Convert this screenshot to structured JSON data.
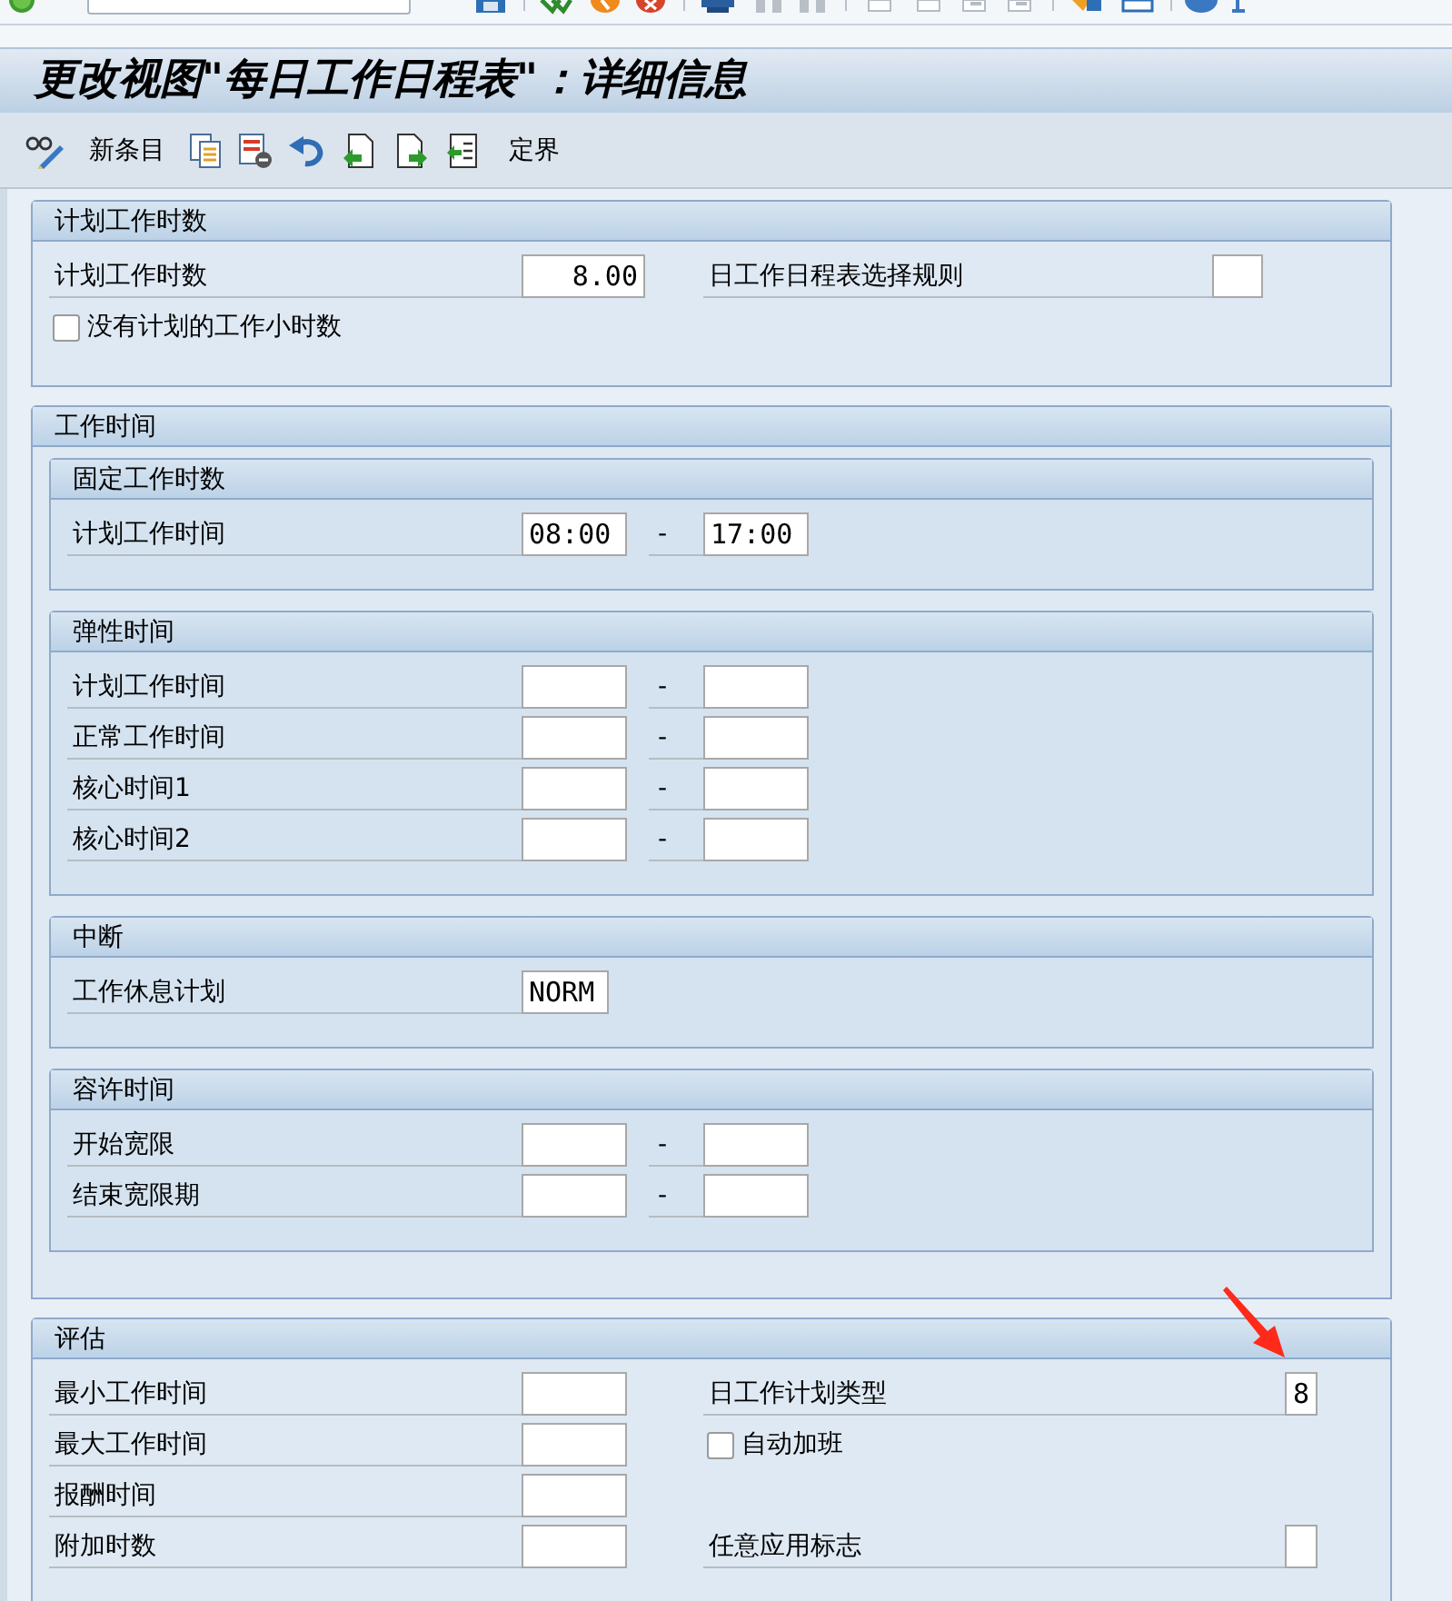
{
  "title": "更改视图\"每日工作日程表\"：详细信息",
  "toolbar": {
    "new_entries": "新条目",
    "delimit": "定界"
  },
  "sections": [
    {
      "title": "计划工作时数",
      "rows": [
        {
          "left": {
            "kind": "number",
            "label": "计划工作时数",
            "value": "8.00"
          },
          "right": {
            "kind": "flag",
            "label": "日工作日程表选择规则"
          }
        },
        {
          "left": {
            "kind": "checkbox",
            "label": "没有计划的工作小时数",
            "checked": false
          }
        }
      ]
    },
    {
      "title": "工作时间",
      "subsections": [
        {
          "title": "固定工作时数",
          "rows": [
            {
              "left": {
                "kind": "range",
                "label": "计划工作时间",
                "from": "08:00",
                "separator": "-",
                "to": "17:00"
              }
            }
          ]
        },
        {
          "title": "弹性时间",
          "rows": [
            {
              "left": {
                "kind": "range",
                "label": "计划工作时间",
                "separator": "-"
              }
            },
            {
              "left": {
                "kind": "range",
                "label": "正常工作时间",
                "separator": "-"
              }
            },
            {
              "left": {
                "kind": "range",
                "label": "核心时间1",
                "separator": "-"
              }
            },
            {
              "left": {
                "kind": "range",
                "label": "核心时间2",
                "separator": "-"
              }
            }
          ]
        },
        {
          "title": "中断",
          "rows": [
            {
              "left": {
                "kind": "code",
                "label": "工作休息计划",
                "value": "NORM"
              }
            }
          ]
        },
        {
          "title": "容许时间",
          "rows": [
            {
              "left": {
                "kind": "range",
                "label": "开始宽限",
                "separator": "-"
              }
            },
            {
              "left": {
                "kind": "range",
                "label": "结束宽限期",
                "separator": "-"
              }
            }
          ]
        }
      ]
    },
    {
      "title": "评估",
      "rows": [
        {
          "left": {
            "kind": "time",
            "label": "最小工作时间"
          },
          "right": {
            "kind": "char",
            "label": "日工作计划类型",
            "value": "8"
          }
        },
        {
          "left": {
            "kind": "time",
            "label": "最大工作时间"
          },
          "right": {
            "kind": "checkbox",
            "label": "自动加班",
            "checked": false
          }
        },
        {
          "left": {
            "kind": "time",
            "label": "报酬时间"
          }
        },
        {
          "left": {
            "kind": "time",
            "label": "附加时数"
          },
          "right": {
            "kind": "char",
            "label": "任意应用标志"
          }
        }
      ]
    }
  ]
}
